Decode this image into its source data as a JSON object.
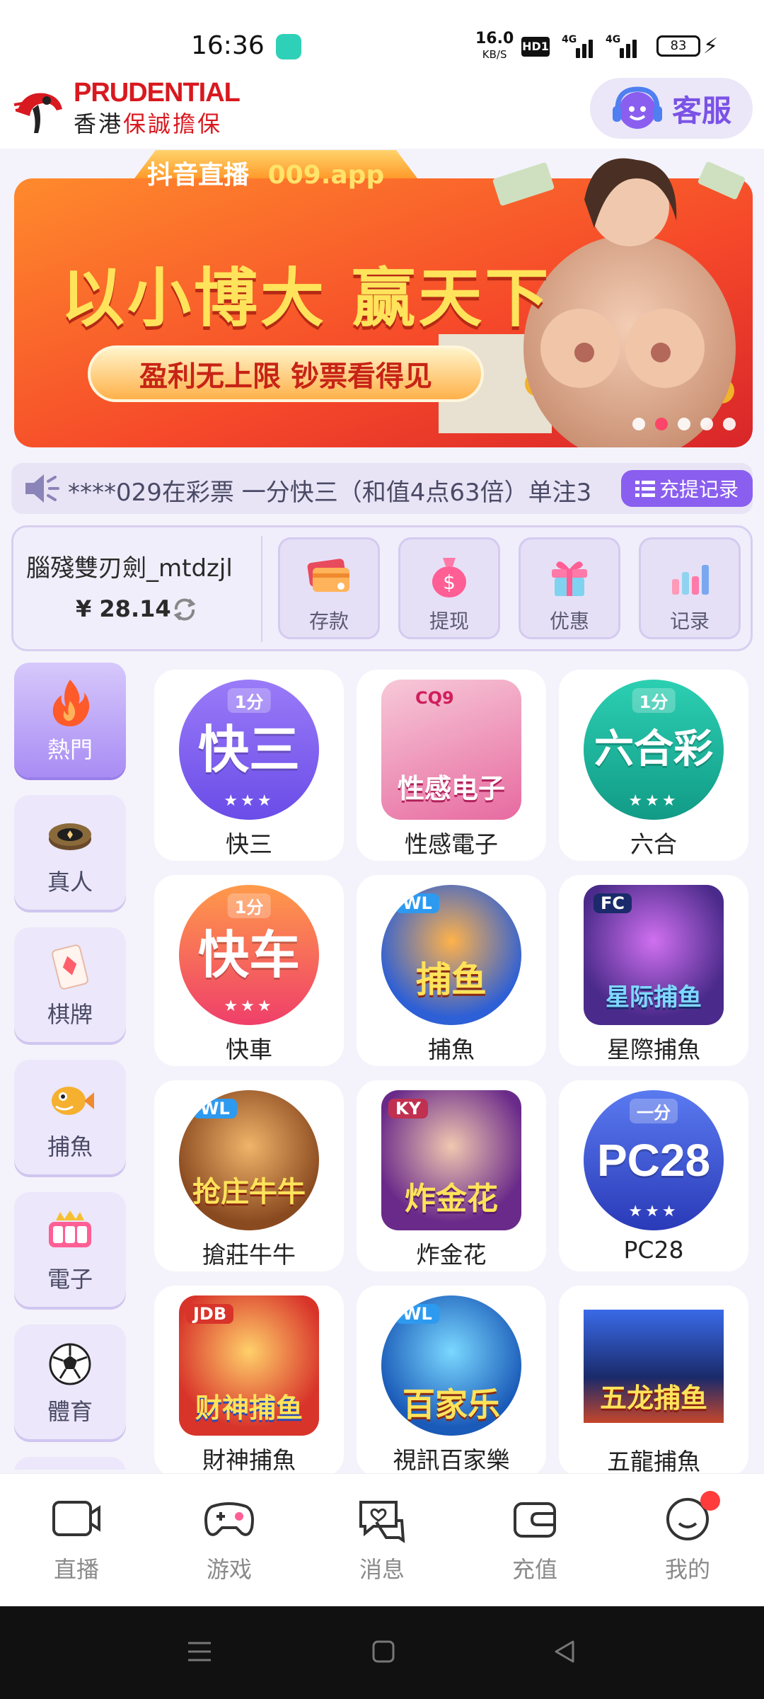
{
  "status_bar": {
    "time": "16:36",
    "net_speed": "16.0",
    "net_unit": "KB/S",
    "hd_label": "HD1",
    "sim1_label": "4G",
    "sim2_label": "4G",
    "battery": "83"
  },
  "header": {
    "logo_title": "PRUDENTIAL",
    "logo_sub_a": "香港",
    "logo_sub_b": "保誠擔保",
    "service_label": "客服"
  },
  "banner": {
    "tag": "抖音直播",
    "tag_app": "009.app",
    "headline": "以小博大 赢天下",
    "sub": "盈利无上限 钞票看得见",
    "active_slide": 2,
    "slide_count": 5
  },
  "notice": {
    "text": "****029在彩票 一分快三（和值4点63倍）单注3",
    "button": "充提记录"
  },
  "wallet": {
    "username": "腦殘雙刃劍_mtdzjl",
    "currency": "¥",
    "balance": "28.14",
    "actions": [
      {
        "label": "存款",
        "icon": "card-icon"
      },
      {
        "label": "提现",
        "icon": "money-bag-icon"
      },
      {
        "label": "优惠",
        "icon": "gift-icon"
      },
      {
        "label": "记录",
        "icon": "bar-chart-icon"
      }
    ]
  },
  "categories": [
    {
      "label": "熱門",
      "icon": "fire-icon",
      "active": true
    },
    {
      "label": "真人",
      "icon": "chip-icon",
      "active": false
    },
    {
      "label": "棋牌",
      "icon": "card-icon",
      "active": false
    },
    {
      "label": "捕魚",
      "icon": "fish-icon",
      "active": false
    },
    {
      "label": "電子",
      "icon": "slot-icon",
      "active": false
    },
    {
      "label": "體育",
      "icon": "soccer-ball-icon",
      "active": false
    }
  ],
  "games": [
    {
      "name": "快三",
      "thumb": "快三",
      "tag": "1分",
      "color": "#7b5cf0"
    },
    {
      "name": "性感電子",
      "thumb": "性感电子",
      "tag": "CQ9",
      "color": "#e76aa0"
    },
    {
      "name": "六合",
      "thumb": "六合彩",
      "tag": "1分",
      "color": "#19b59c"
    },
    {
      "name": "快車",
      "thumb": "快车",
      "tag": "1分",
      "color": "#f0574a"
    },
    {
      "name": "捕魚",
      "thumb": "捕鱼",
      "tag": "WL",
      "color": "#2d5fd6"
    },
    {
      "name": "星際捕魚",
      "thumb": "星际捕鱼",
      "tag": "FC",
      "color": "#a93fcf"
    },
    {
      "name": "搶莊牛牛",
      "thumb": "抢庄牛牛",
      "tag": "WL",
      "color": "#c77a2b"
    },
    {
      "name": "炸金花",
      "thumb": "炸金花",
      "tag": "KY",
      "color": "#8a3fb0"
    },
    {
      "name": "PC28",
      "thumb": "PC28",
      "tag": "一分",
      "color": "#3a52d8"
    },
    {
      "name": "財神捕魚",
      "thumb": "财神捕鱼",
      "tag": "JDB",
      "color": "#d8342a"
    },
    {
      "name": "視訊百家樂",
      "thumb": "百家乐",
      "tag": "WL",
      "color": "#2a8ad8"
    },
    {
      "name": "五龍捕魚",
      "thumb": "五龙捕鱼",
      "tag": "",
      "color": "#c5462c"
    }
  ],
  "bottom_nav": [
    {
      "label": "直播",
      "icon": "video-camera-icon"
    },
    {
      "label": "游戏",
      "icon": "gamepad-icon"
    },
    {
      "label": "消息",
      "icon": "chat-heart-icon"
    },
    {
      "label": "充值",
      "icon": "wallet-icon"
    },
    {
      "label": "我的",
      "icon": "smiley-icon",
      "badge": true
    }
  ],
  "colors": {
    "accent": "#8a5fef",
    "brand_red": "#d8191f",
    "background": "#f4f3fb"
  }
}
